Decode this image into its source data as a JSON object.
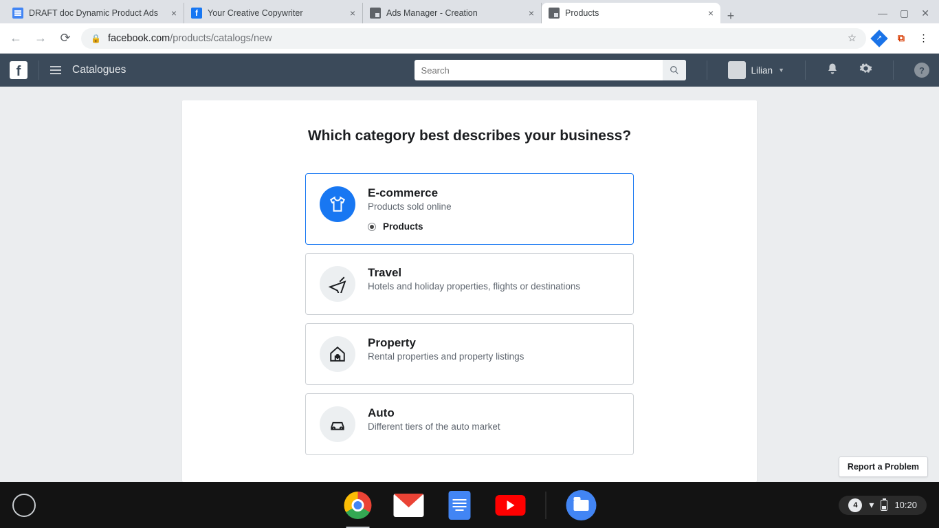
{
  "browser": {
    "tabs": [
      {
        "title": "DRAFT doc Dynamic Product Ads"
      },
      {
        "title": "Your Creative Copywriter"
      },
      {
        "title": "Ads Manager - Creation"
      },
      {
        "title": "Products"
      }
    ],
    "url_host": "facebook.com",
    "url_path": "/products/catalogs/new"
  },
  "fb_header": {
    "section": "Catalogues",
    "search_placeholder": "Search",
    "user": "Lilian"
  },
  "page": {
    "heading": "Which category best describes your business?",
    "options": [
      {
        "title": "E-commerce",
        "desc": "Products sold online",
        "sub": "Products"
      },
      {
        "title": "Travel",
        "desc": "Hotels and holiday properties, flights or destinations"
      },
      {
        "title": "Property",
        "desc": "Rental properties and property listings"
      },
      {
        "title": "Auto",
        "desc": "Different tiers of the auto market"
      }
    ],
    "report": "Report a Problem"
  },
  "tray": {
    "count": "4",
    "time": "10:20"
  }
}
